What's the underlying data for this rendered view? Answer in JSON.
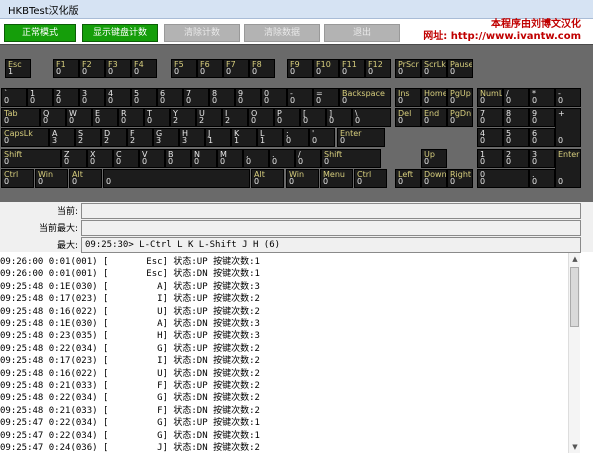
{
  "window": {
    "title": "HKBTest汉化版"
  },
  "toolbar": {
    "buttons": [
      {
        "label": "正常模式",
        "enabled": true
      },
      {
        "label": "显示键盘计数",
        "enabled": true
      },
      {
        "label": "清除计数",
        "enabled": false
      },
      {
        "label": "清除数据",
        "enabled": false
      },
      {
        "label": "退出",
        "enabled": false
      }
    ],
    "brand_line1": "本程序由刘博文汉化",
    "brand_line2": "网址: http://www.ivantw.com"
  },
  "keyboard": {
    "keys": [
      {
        "label": "Esc",
        "count": "1"
      },
      {
        "label": "F1",
        "count": "0"
      },
      {
        "label": "F2",
        "count": "0"
      },
      {
        "label": "F3",
        "count": "0"
      },
      {
        "label": "F4",
        "count": "0"
      },
      {
        "label": "F5",
        "count": "0"
      },
      {
        "label": "F6",
        "count": "0"
      },
      {
        "label": "F7",
        "count": "0"
      },
      {
        "label": "F8",
        "count": "0"
      },
      {
        "label": "F9",
        "count": "0"
      },
      {
        "label": "F10",
        "count": "0"
      },
      {
        "label": "F11",
        "count": "0"
      },
      {
        "label": "F12",
        "count": "0"
      },
      {
        "label": "PrScr",
        "count": "0"
      },
      {
        "label": "ScrLk",
        "count": "0"
      },
      {
        "label": "Pause",
        "count": "0"
      },
      {
        "label": "`",
        "count": "0"
      },
      {
        "label": "1",
        "count": "0"
      },
      {
        "label": "2",
        "count": "0"
      },
      {
        "label": "3",
        "count": "0"
      },
      {
        "label": "4",
        "count": "0"
      },
      {
        "label": "5",
        "count": "0"
      },
      {
        "label": "6",
        "count": "0"
      },
      {
        "label": "7",
        "count": "0"
      },
      {
        "label": "8",
        "count": "0"
      },
      {
        "label": "9",
        "count": "0"
      },
      {
        "label": "0",
        "count": "0"
      },
      {
        "label": "-",
        "count": "0"
      },
      {
        "label": "=",
        "count": "0"
      },
      {
        "label": "Backspace",
        "count": "0"
      },
      {
        "label": "Ins",
        "count": "0"
      },
      {
        "label": "Home",
        "count": "0"
      },
      {
        "label": "PgUp",
        "count": "0"
      },
      {
        "label": "NumLk",
        "count": "0"
      },
      {
        "label": "/",
        "count": "0"
      },
      {
        "label": "*",
        "count": "0"
      },
      {
        "label": "-",
        "count": "0"
      },
      {
        "label": "Tab",
        "count": "0"
      },
      {
        "label": "Q",
        "count": "0"
      },
      {
        "label": "W",
        "count": "0"
      },
      {
        "label": "E",
        "count": "0"
      },
      {
        "label": "R",
        "count": "0"
      },
      {
        "label": "T",
        "count": "0"
      },
      {
        "label": "Y",
        "count": "2"
      },
      {
        "label": "U",
        "count": "2"
      },
      {
        "label": "I",
        "count": "2"
      },
      {
        "label": "O",
        "count": "0"
      },
      {
        "label": "P",
        "count": "0"
      },
      {
        "label": "[",
        "count": "0"
      },
      {
        "label": "]",
        "count": "0"
      },
      {
        "label": "\\",
        "count": "0"
      },
      {
        "label": "Del",
        "count": "0"
      },
      {
        "label": "End",
        "count": "0"
      },
      {
        "label": "PgDn",
        "count": "0"
      },
      {
        "label": "7",
        "count": "0"
      },
      {
        "label": "8",
        "count": "0"
      },
      {
        "label": "9",
        "count": "0"
      },
      {
        "label": "+",
        "count": "0"
      },
      {
        "label": "CapsLk",
        "count": "0"
      },
      {
        "label": "A",
        "count": "3"
      },
      {
        "label": "S",
        "count": "2"
      },
      {
        "label": "D",
        "count": "2"
      },
      {
        "label": "F",
        "count": "2"
      },
      {
        "label": "G",
        "count": "3"
      },
      {
        "label": "H",
        "count": "3"
      },
      {
        "label": "J",
        "count": "1"
      },
      {
        "label": "K",
        "count": "1"
      },
      {
        "label": "L",
        "count": "1"
      },
      {
        "label": ";",
        "count": "0"
      },
      {
        "label": "'",
        "count": "0"
      },
      {
        "label": "Enter",
        "count": "0"
      },
      {
        "label": "4",
        "count": "0"
      },
      {
        "label": "5",
        "count": "0"
      },
      {
        "label": "6",
        "count": "0"
      },
      {
        "label": "Shift",
        "count": "0"
      },
      {
        "label": "Z",
        "count": "0"
      },
      {
        "label": "X",
        "count": "0"
      },
      {
        "label": "C",
        "count": "0"
      },
      {
        "label": "V",
        "count": "0"
      },
      {
        "label": "B",
        "count": "0"
      },
      {
        "label": "N",
        "count": "0"
      },
      {
        "label": "M",
        "count": "0"
      },
      {
        "label": ",",
        "count": "0"
      },
      {
        "label": ".",
        "count": "0"
      },
      {
        "label": "/",
        "count": "0"
      },
      {
        "label": "Shift",
        "count": "0"
      },
      {
        "label": "Up",
        "count": "0"
      },
      {
        "label": "1",
        "count": "0"
      },
      {
        "label": "2",
        "count": "0"
      },
      {
        "label": "3",
        "count": "0"
      },
      {
        "label": "Enter",
        "count": "0"
      },
      {
        "label": "Ctrl",
        "count": "0"
      },
      {
        "label": "Win",
        "count": "0"
      },
      {
        "label": "Alt",
        "count": "0"
      },
      {
        "label": "",
        "count": "0"
      },
      {
        "label": "Alt",
        "count": "0"
      },
      {
        "label": "Win",
        "count": "0"
      },
      {
        "label": "Menu",
        "count": "0"
      },
      {
        "label": "Ctrl",
        "count": "0"
      },
      {
        "label": "Left",
        "count": "0"
      },
      {
        "label": "Down",
        "count": "0"
      },
      {
        "label": "Right",
        "count": "0"
      },
      {
        "label": "0",
        "count": "0"
      },
      {
        "label": ".",
        "count": "0"
      }
    ]
  },
  "fields": {
    "current_label": "当前:",
    "current_value": "",
    "current_max_label": "当前最大:",
    "current_max_value": "",
    "max_label": "最大:",
    "max_value": "09:25:30> L-Ctrl L K L-Shift J H (6)"
  },
  "log": [
    "09:26:00 0:01(001) [       Esc] 状态:UP 按键次数:1",
    "09:26:00 0:01(001) [       Esc] 状态:DN 按键次数:1",
    "09:25:48 0:1E(030) [         A] 状态:UP 按键次数:3",
    "09:25:48 0:17(023) [         I] 状态:UP 按键次数:2",
    "09:25:48 0:16(022) [         U] 状态:UP 按键次数:2",
    "09:25:48 0:1E(030) [         A] 状态:DN 按键次数:3",
    "09:25:48 0:23(035) [         H] 状态:UP 按键次数:3",
    "09:25:48 0:22(034) [         G] 状态:UP 按键次数:2",
    "09:25:48 0:17(023) [         I] 状态:DN 按键次数:2",
    "09:25:48 0:16(022) [         U] 状态:DN 按键次数:2",
    "09:25:48 0:21(033) [         F] 状态:UP 按键次数:2",
    "09:25:48 0:22(034) [         G] 状态:DN 按键次数:2",
    "09:25:48 0:21(033) [         F] 状态:DN 按键次数:2",
    "09:25:47 0:22(034) [         G] 状态:UP 按键次数:1",
    "09:25:47 0:22(034) [         G] 状态:DN 按键次数:1",
    "09:25:47 0:24(036) [         J] 状态:DN 按键次数:2"
  ]
}
